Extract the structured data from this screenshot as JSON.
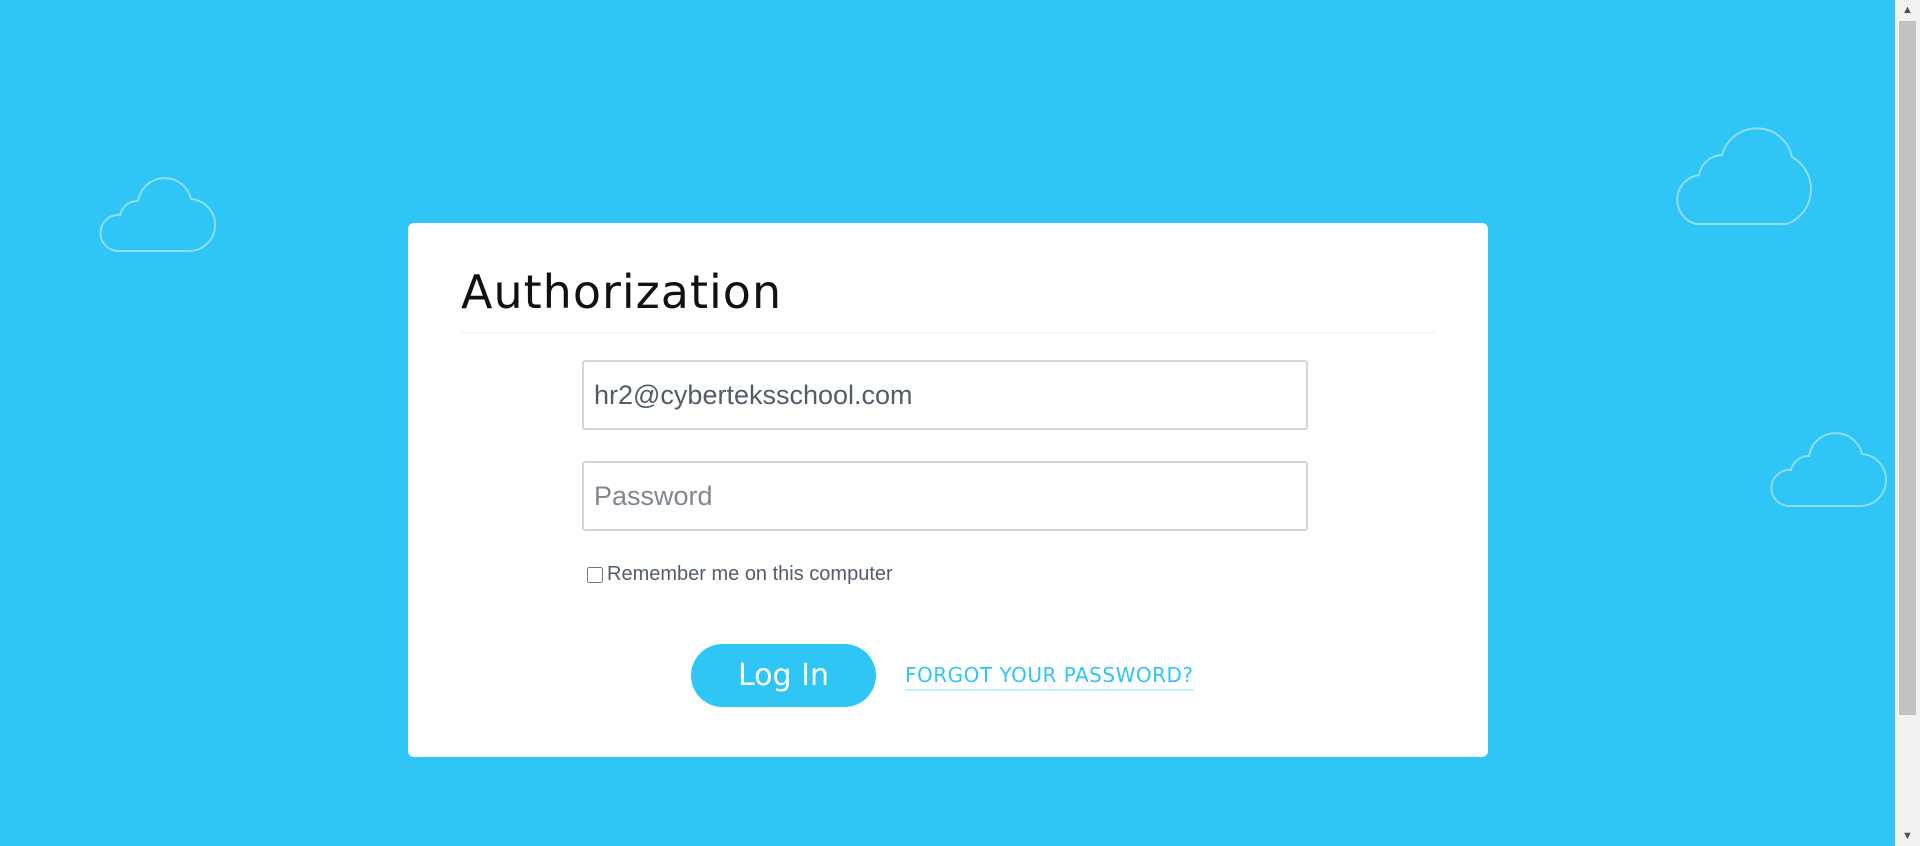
{
  "login_form": {
    "title": "Authorization",
    "login_value": "hr2@cyberteksschool.com",
    "login_placeholder": "",
    "password_value": "",
    "password_placeholder": "Password",
    "remember_label": "Remember me on this computer",
    "remember_checked": false,
    "submit_label": "Log In",
    "forgot_label": "FORGOT YOUR PASSWORD?"
  },
  "colors": {
    "background": "#2fc6f6",
    "accent": "#2fc6f6",
    "card": "#ffffff"
  },
  "icons": {
    "decorations": [
      "cloud-icon",
      "cloud-icon",
      "cloud-icon"
    ],
    "scrollbar": [
      "arrow-up-icon",
      "arrow-down-icon"
    ]
  }
}
